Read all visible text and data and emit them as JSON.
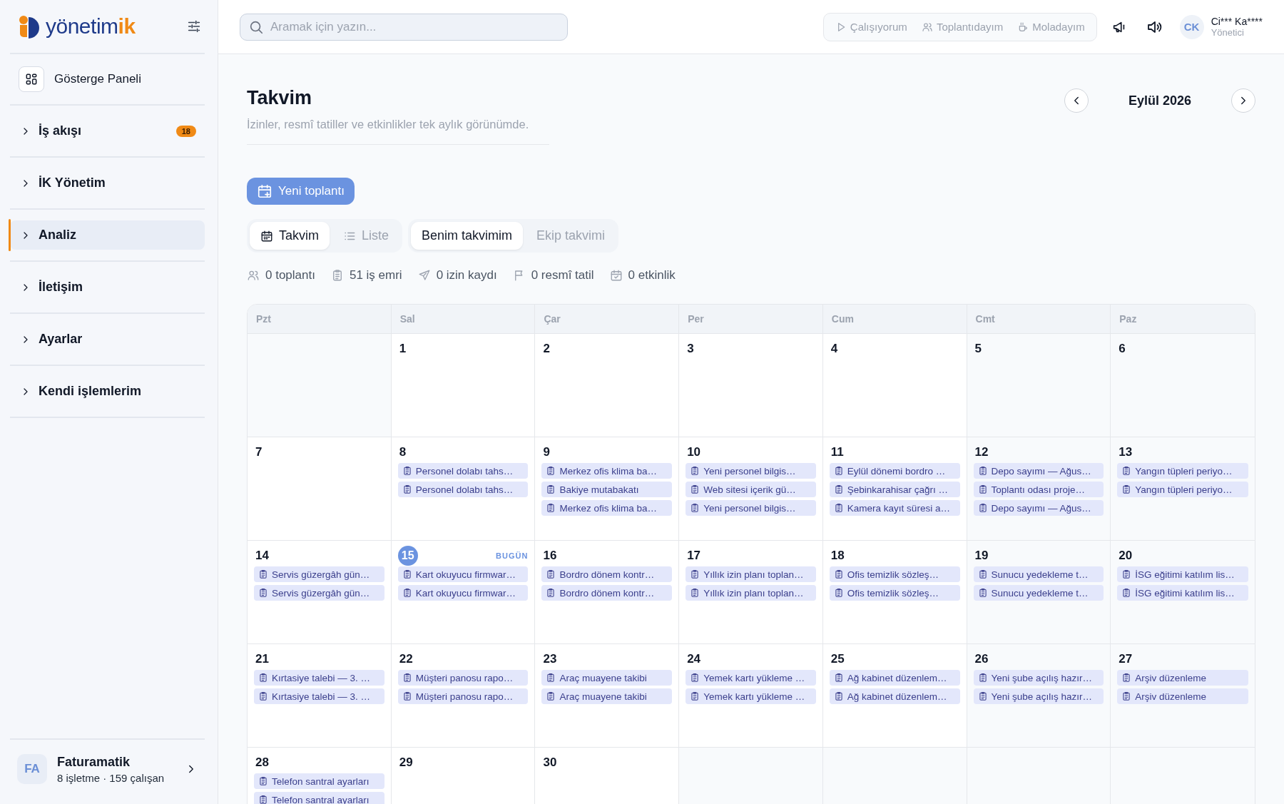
{
  "sidebar": {
    "logo": {
      "text": "yönetim",
      "accent": "ik"
    },
    "dashboard": {
      "label": "Gösterge Paneli"
    },
    "items": [
      {
        "label": "İş akışı",
        "badge": "18",
        "expanded": false,
        "selected": false
      },
      {
        "label": "İK Yönetim",
        "expanded": false,
        "selected": false
      },
      {
        "label": "Analiz",
        "expanded": false,
        "selected": true
      },
      {
        "label": "İletişim",
        "expanded": false,
        "selected": false
      },
      {
        "label": "Ayarlar",
        "expanded": false,
        "selected": false
      },
      {
        "label": "Kendi işlemlerim",
        "expanded": false,
        "selected": false
      }
    ],
    "company": {
      "initials": "FA",
      "name": "Faturamatik",
      "details": "8 işletme · 159 çalışan"
    }
  },
  "topbar": {
    "search": {
      "placeholder": "Aramak için yazın..."
    },
    "statuses": [
      {
        "kind": "working",
        "label": "Çalışıyorum",
        "selected": false
      },
      {
        "kind": "meeting",
        "label": "Toplantıdayım",
        "selected": false
      },
      {
        "kind": "break",
        "label": "Moladayım",
        "selected": false
      }
    ],
    "user": {
      "initials": "CK",
      "name": "Ci*** Ka****",
      "role": "Yönetici"
    }
  },
  "page": {
    "title": "Takvim",
    "subtitle": "İzinler, resmî tatiller ve etkinlikler tek aylık görünümde.",
    "month": "Eylül 2026",
    "new_button": "Yeni toplantı",
    "view_tabs": [
      {
        "kind": "calendar",
        "label": "Takvim",
        "selected": true
      },
      {
        "kind": "list",
        "label": "Liste",
        "selected": false
      }
    ],
    "scope_tabs": [
      {
        "label": "Benim takvimim",
        "selected": true
      },
      {
        "label": "Ekip takvimi",
        "selected": false
      }
    ],
    "stats": [
      {
        "kind": "meetings",
        "text": "0 toplantı"
      },
      {
        "kind": "tasks",
        "text": "51 iş emri"
      },
      {
        "kind": "leave",
        "text": "0 izin kaydı"
      },
      {
        "kind": "holiday",
        "text": "0 resmî tatil"
      },
      {
        "kind": "events",
        "text": "0 etkinlik"
      }
    ]
  },
  "calendar": {
    "weekdays": [
      "Pzt",
      "Sal",
      "Çar",
      "Per",
      "Cum",
      "Cmt",
      "Paz"
    ],
    "weeks": [
      [
        {
          "kind": "empty"
        },
        {
          "kind": "day",
          "day": "1",
          "today": false
        },
        {
          "kind": "day",
          "day": "2",
          "today": false
        },
        {
          "kind": "day",
          "day": "3",
          "today": false
        },
        {
          "kind": "day",
          "day": "4",
          "today": false
        },
        {
          "kind": "day",
          "day": "5",
          "today": false
        },
        {
          "kind": "day",
          "day": "6",
          "today": false
        }
      ],
      [
        {
          "kind": "day",
          "day": "7",
          "today": false
        },
        {
          "kind": "day",
          "day": "8",
          "today": false,
          "events": [
            "Personel dolabı tahs…",
            "Personel dolabı tahs…"
          ]
        },
        {
          "kind": "day",
          "day": "9",
          "today": false,
          "events": [
            "Merkez ofis klima ba…",
            "Bakiye mutabakatı",
            "Merkez ofis klima ba…"
          ]
        },
        {
          "kind": "day",
          "day": "10",
          "today": false,
          "events": [
            "Yeni personel bilgis…",
            "Web sitesi içerik gü…",
            "Yeni personel bilgis…"
          ]
        },
        {
          "kind": "day",
          "day": "11",
          "today": false,
          "events": [
            "Eylül dönemi bordro …",
            "Şebinkarahisar çağrı …",
            "Kamera kayıt süresi a…"
          ]
        },
        {
          "kind": "day",
          "day": "12",
          "today": false,
          "events": [
            "Depo sayımı — Ağus…",
            "Toplantı odası proje…",
            "Depo sayımı — Ağus…"
          ]
        },
        {
          "kind": "day",
          "day": "13",
          "today": false,
          "events": [
            "Yangın tüpleri periyo…",
            "Yangın tüpleri periyo…"
          ]
        }
      ],
      [
        {
          "kind": "day",
          "day": "14",
          "today": false,
          "events": [
            "Servis güzergâh gün…",
            "Servis güzergâh gün…"
          ]
        },
        {
          "kind": "day",
          "day": "15",
          "today": true,
          "badge": "BUGÜN",
          "events": [
            "Kart okuyucu firmwar…",
            "Kart okuyucu firmwar…"
          ]
        },
        {
          "kind": "day",
          "day": "16",
          "today": false,
          "events": [
            "Bordro dönem kontr…",
            "Bordro dönem kontr…"
          ]
        },
        {
          "kind": "day",
          "day": "17",
          "today": false,
          "events": [
            "Yıllık izin planı toplan…",
            "Yıllık izin planı toplan…"
          ]
        },
        {
          "kind": "day",
          "day": "18",
          "today": false,
          "events": [
            "Ofis temizlik sözleş…",
            "Ofis temizlik sözleş…"
          ]
        },
        {
          "kind": "day",
          "day": "19",
          "today": false,
          "events": [
            "Sunucu yedekleme t…",
            "Sunucu yedekleme t…"
          ]
        },
        {
          "kind": "day",
          "day": "20",
          "today": false,
          "events": [
            "İSG eğitimi katılım lis…",
            "İSG eğitimi katılım lis…"
          ]
        }
      ],
      [
        {
          "kind": "day",
          "day": "21",
          "today": false,
          "events": [
            "Kırtasiye talebi — 3. …",
            "Kırtasiye talebi — 3. …"
          ]
        },
        {
          "kind": "day",
          "day": "22",
          "today": false,
          "events": [
            "Müşteri panosu rapo…",
            "Müşteri panosu rapo…"
          ]
        },
        {
          "kind": "day",
          "day": "23",
          "today": false,
          "events": [
            "Araç muayene takibi",
            "Araç muayene takibi"
          ]
        },
        {
          "kind": "day",
          "day": "24",
          "today": false,
          "events": [
            "Yemek kartı yükleme …",
            "Yemek kartı yükleme …"
          ]
        },
        {
          "kind": "day",
          "day": "25",
          "today": false,
          "events": [
            "Ağ kabinet düzenlem…",
            "Ağ kabinet düzenlem…"
          ]
        },
        {
          "kind": "day",
          "day": "26",
          "today": false,
          "events": [
            "Yeni şube açılış hazır…",
            "Yeni şube açılış hazır…"
          ]
        },
        {
          "kind": "day",
          "day": "27",
          "today": false,
          "events": [
            "Arşiv düzenleme",
            "Arşiv düzenleme"
          ]
        }
      ],
      [
        {
          "kind": "day",
          "day": "28",
          "today": false,
          "events": [
            "Telefon santral ayarları",
            "Telefon santral ayarları"
          ]
        },
        {
          "kind": "day",
          "day": "29",
          "today": false
        },
        {
          "kind": "day",
          "day": "30",
          "today": false
        },
        {
          "kind": "empty"
        },
        {
          "kind": "empty"
        },
        {
          "kind": "empty"
        },
        {
          "kind": "empty"
        }
      ]
    ]
  }
}
